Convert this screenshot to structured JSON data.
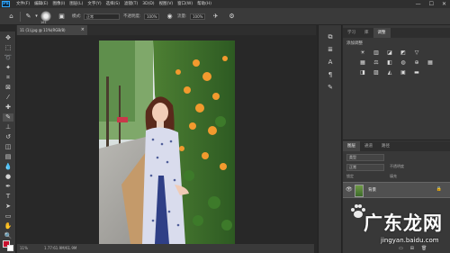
{
  "app": {
    "logo": "Ps",
    "menu": [
      "文件(F)",
      "编辑(E)",
      "图像(I)",
      "图层(L)",
      "文字(Y)",
      "选择(S)",
      "滤镜(T)",
      "3D(D)",
      "视图(V)",
      "窗口(W)",
      "帮助(H)"
    ],
    "window_controls": [
      "—",
      "☐",
      "✕"
    ]
  },
  "options_bar": {
    "brush_size": "161",
    "mode_label": "模式:",
    "mode_value": "正常",
    "opacity_label": "不透明度:",
    "opacity_value": "100%",
    "flow_label": "流量:",
    "flow_value": "100%"
  },
  "document": {
    "tab_title": "11 (1).jpg @ 11%(RGB/8)",
    "tab_close": "×",
    "zoom": "11%",
    "status": "1.77:61.9M/61.9M"
  },
  "panels": {
    "top_tabs": [
      "学习",
      "库",
      "调整"
    ],
    "adjust_subtitle": "添加调整",
    "layer_tabs": [
      "图层",
      "通道",
      "路径"
    ],
    "filter_label": "类型",
    "blend_mode": "正常",
    "opacity_label": "不透明度",
    "lock_label": "锁定",
    "fill_label": "填充",
    "layer_name": "背景"
  },
  "watermark": {
    "title": "广东龙网",
    "url": "jingyan.baidu.com"
  },
  "colors": {
    "accent": "#31a8ff",
    "foreground": "#c8102e",
    "background": "#ffffff"
  }
}
